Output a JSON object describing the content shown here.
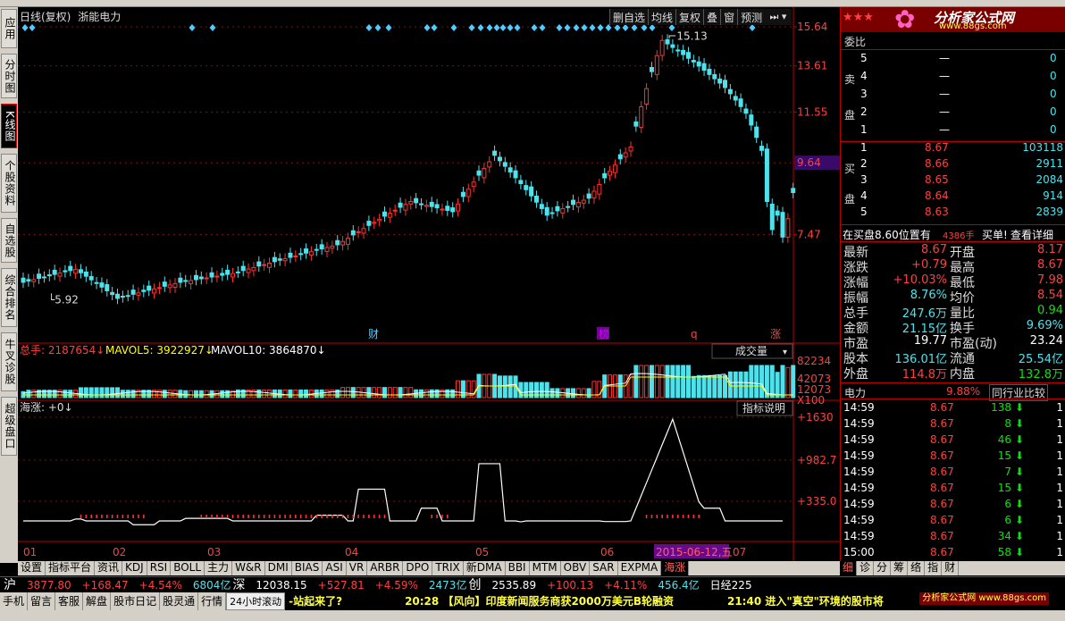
{
  "top": {
    "title": "日线(复权)",
    "stock": "浙能电力",
    "buttons": [
      "删自选",
      "均线",
      "复权",
      "叠",
      "窗",
      "预测"
    ]
  },
  "left_tabs": [
    "应用",
    "分时图",
    "K线图",
    "个股资料",
    "自选股",
    "综合排名",
    "牛叉诊股",
    "超级盘口"
  ],
  "price_axis": [
    "15.64",
    "13.61",
    "11.55",
    "9.64",
    "7.47"
  ],
  "price_cursor": "9.64",
  "markers": {
    "high": "15.13",
    "low": "5.92",
    "cai": "财",
    "bang": "榜",
    "q": "q",
    "zhang": "涨"
  },
  "volume": {
    "total_label": "总手: 2187654",
    "mavol5": "MAVOL5: 3922927",
    "mavol10": "MAVOL10: 3864870",
    "type": "成交量",
    "axis": [
      "82234",
      "42073",
      "12073",
      "X100"
    ]
  },
  "indicator": {
    "label": "海涨: +0",
    "button": "指标说明",
    "axis": [
      "+1630",
      "+982.7",
      "+335.0"
    ]
  },
  "dates": [
    "01",
    "02",
    "03",
    "04",
    "05",
    "06",
    "07"
  ],
  "date_cursor": "2015-06-12,五",
  "bottom_tabs": [
    "设置",
    "指标平台",
    "资讯",
    "KDJ",
    "RSI",
    "BOLL",
    "主力",
    "W&R",
    "DMI",
    "BIAS",
    "ASI",
    "VR",
    "ARBR",
    "DPO",
    "TRIX",
    "新DMA",
    "BBI",
    "MTM",
    "OBV",
    "SAR",
    "EXPMA",
    "海涨"
  ],
  "right_tabs": [
    "细",
    "诊",
    "分",
    "筹",
    "络",
    "指",
    "财"
  ],
  "logo": {
    "text": "分析家公式网",
    "url": "www.88gs.com"
  },
  "weibi": "委比",
  "sell_label": "卖盘",
  "buy_label": "买盘",
  "sell": [
    {
      "n": "5",
      "p": "—",
      "v": "0"
    },
    {
      "n": "4",
      "p": "—",
      "v": "0"
    },
    {
      "n": "3",
      "p": "—",
      "v": "0"
    },
    {
      "n": "2",
      "p": "—",
      "v": "0"
    },
    {
      "n": "1",
      "p": "—",
      "v": "0"
    }
  ],
  "buy": [
    {
      "n": "1",
      "p": "8.67",
      "v": "103118"
    },
    {
      "n": "2",
      "p": "8.66",
      "v": "2911"
    },
    {
      "n": "3",
      "p": "8.65",
      "v": "2084"
    },
    {
      "n": "4",
      "p": "8.64",
      "v": "914"
    },
    {
      "n": "5",
      "p": "8.63",
      "v": "2839"
    }
  ],
  "notice": {
    "a": "在买盘8.60位置有",
    "b": "4386手",
    "c": "买单!",
    "d": "查看详细"
  },
  "quote": [
    {
      "l1": "最新",
      "v1": "8.67",
      "c1": "red",
      "l2": "开盘",
      "v2": "8.17",
      "c2": "red"
    },
    {
      "l1": "涨跌",
      "v1": "+0.79",
      "c1": "red",
      "l2": "最高",
      "v2": "8.67",
      "c2": "red"
    },
    {
      "l1": "涨幅",
      "v1": "+10.03%",
      "c1": "red",
      "l2": "最低",
      "v2": "7.98",
      "c2": "red"
    },
    {
      "l1": "振幅",
      "v1": "8.76%",
      "c1": "cyan",
      "l2": "均价",
      "v2": "8.54",
      "c2": "red"
    },
    {
      "l1": "总手",
      "v1": "247.6万",
      "c1": "cyan",
      "l2": "量比",
      "v2": "0.94",
      "c2": "green"
    },
    {
      "l1": "金额",
      "v1": "21.15亿",
      "c1": "cyan",
      "l2": "换手",
      "v2": "9.69%",
      "c2": "cyan"
    },
    {
      "l1": "市盈",
      "v1": "19.77",
      "c1": "white",
      "l2": "市盈(动)",
      "v2": "23.24",
      "c2": "white"
    },
    {
      "l1": "股本",
      "v1": "136.01亿",
      "c1": "cyan",
      "l2": "流通",
      "v2": "25.54亿",
      "c2": "cyan"
    },
    {
      "l1": "外盘",
      "v1": "114.8万",
      "c1": "red",
      "l2": "内盘",
      "v2": "132.8万",
      "c2": "green"
    }
  ],
  "sector": {
    "name": "电力",
    "pct": "9.88%",
    "btn": "同行业比较"
  },
  "ticks": [
    {
      "t": "14:59",
      "p": "8.67",
      "v": "138",
      "d": "1"
    },
    {
      "t": "14:59",
      "p": "8.67",
      "v": "8",
      "d": "1"
    },
    {
      "t": "14:59",
      "p": "8.67",
      "v": "46",
      "d": "1"
    },
    {
      "t": "14:59",
      "p": "8.67",
      "v": "15",
      "d": "1"
    },
    {
      "t": "14:59",
      "p": "8.67",
      "v": "7",
      "d": "1"
    },
    {
      "t": "14:59",
      "p": "8.67",
      "v": "15",
      "d": "1"
    },
    {
      "t": "14:59",
      "p": "8.67",
      "v": "6",
      "d": "1"
    },
    {
      "t": "14:59",
      "p": "8.67",
      "v": "6",
      "d": "1"
    },
    {
      "t": "14:59",
      "p": "8.67",
      "v": "34",
      "d": "1"
    },
    {
      "t": "15:00",
      "p": "8.67",
      "v": "58",
      "d": "1"
    }
  ],
  "status": {
    "sh": "沪",
    "sh_idx": "3877.80",
    "sh_chg": "+168.47",
    "sh_pct": "+4.54%",
    "sh_amt": "6804亿",
    "sz": "深",
    "sz_idx": "12038.15",
    "sz_chg": "+527.81",
    "sz_pct": "+4.59%",
    "sz_amt": "2473亿",
    "cy": "创",
    "cy_idx": "2535.89",
    "cy_chg": "+100.13",
    "cy_pct": "+4.11%",
    "cy_amt": "456.4亿",
    "extra": "日经225"
  },
  "status2": {
    "items": [
      "手机",
      "留言",
      "客服",
      "解盘",
      "股市日记",
      "股灵通",
      "行情"
    ],
    "scroll_label": "24小时滚动",
    "news1": "-站起来了?",
    "news2": "20:28 【风向】印度新闻服务商获2000万美元B轮融资",
    "news3": "21:40 进入\"真空\"环境的股市将",
    "logo2": "分析家公式网 www.88gs.com"
  }
}
